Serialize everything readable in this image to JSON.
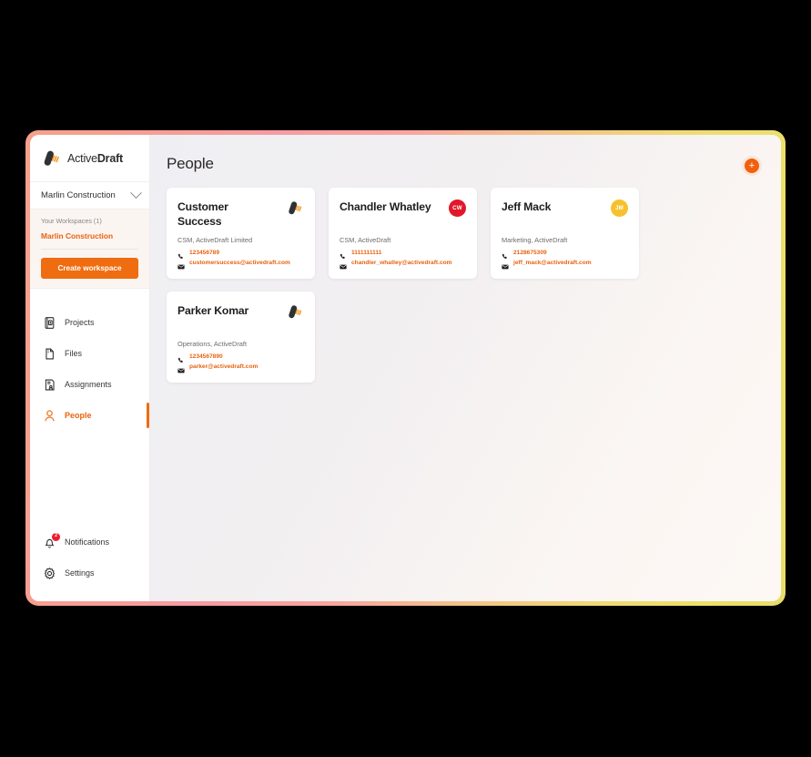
{
  "brand": {
    "name_light": "Active",
    "name_bold": "Draft",
    "logo_icon": "activedraft-logo-mark"
  },
  "sidebar": {
    "workspace_selector": {
      "value": "Marlin Construction",
      "chevron_icon": "chevron-down-icon"
    },
    "workspaces_panel": {
      "label": "Your Workspaces (1)",
      "current": "Marlin Construction",
      "create_button": "Create workspace"
    },
    "nav_items": [
      {
        "label": "Projects",
        "icon": "projects-icon",
        "active": false
      },
      {
        "label": "Files",
        "icon": "files-icon",
        "active": false
      },
      {
        "label": "Assignments",
        "icon": "assignments-icon",
        "active": false
      },
      {
        "label": "People",
        "icon": "people-icon",
        "active": true
      }
    ],
    "bottom_items": [
      {
        "label": "Notifications",
        "icon": "bell-icon",
        "badge": "2"
      },
      {
        "label": "Settings",
        "icon": "gear-icon",
        "badge": ""
      }
    ]
  },
  "header": {
    "title": "People",
    "add_button_label": "+",
    "add_button_icon": "plus-icon"
  },
  "people": [
    {
      "name": "Customer Success",
      "role": "CSM, ActiveDraft Limited",
      "phone": "123456789",
      "email": "customersuccess@activedraft.com",
      "avatar_type": "logo",
      "initials": "",
      "avatar_color": ""
    },
    {
      "name": "Chandler Whatley",
      "role": "CSM, ActiveDraft",
      "phone": "1111111111",
      "email": "chandler_whatley@activedraft.com",
      "avatar_type": "initials",
      "initials": "CW",
      "avatar_color": "#e0182a"
    },
    {
      "name": "Jeff Mack",
      "role": "Marketing, ActiveDraft",
      "phone": "2128675309",
      "email": "jeff_mack@activedraft.com",
      "avatar_type": "initials",
      "initials": "JM",
      "avatar_color": "#f7c12e"
    },
    {
      "name": "Parker Komar",
      "role": "Operations, ActiveDraft",
      "phone": "1234567890",
      "email": "parker@activedraft.com",
      "avatar_type": "logo",
      "initials": "",
      "avatar_color": ""
    }
  ],
  "icons": {
    "phone_icon": "phone-icon",
    "email_icon": "envelope-icon"
  },
  "colors": {
    "accent_orange": "#ef6c10",
    "link_orange": "#e8620f",
    "badge_red": "#ed1c2e",
    "frame_gradient_start": "#f6a08c",
    "frame_gradient_end": "#e8dc6b",
    "sidebar_bg": "#ffffff",
    "main_bg": "#f3f0f2"
  }
}
